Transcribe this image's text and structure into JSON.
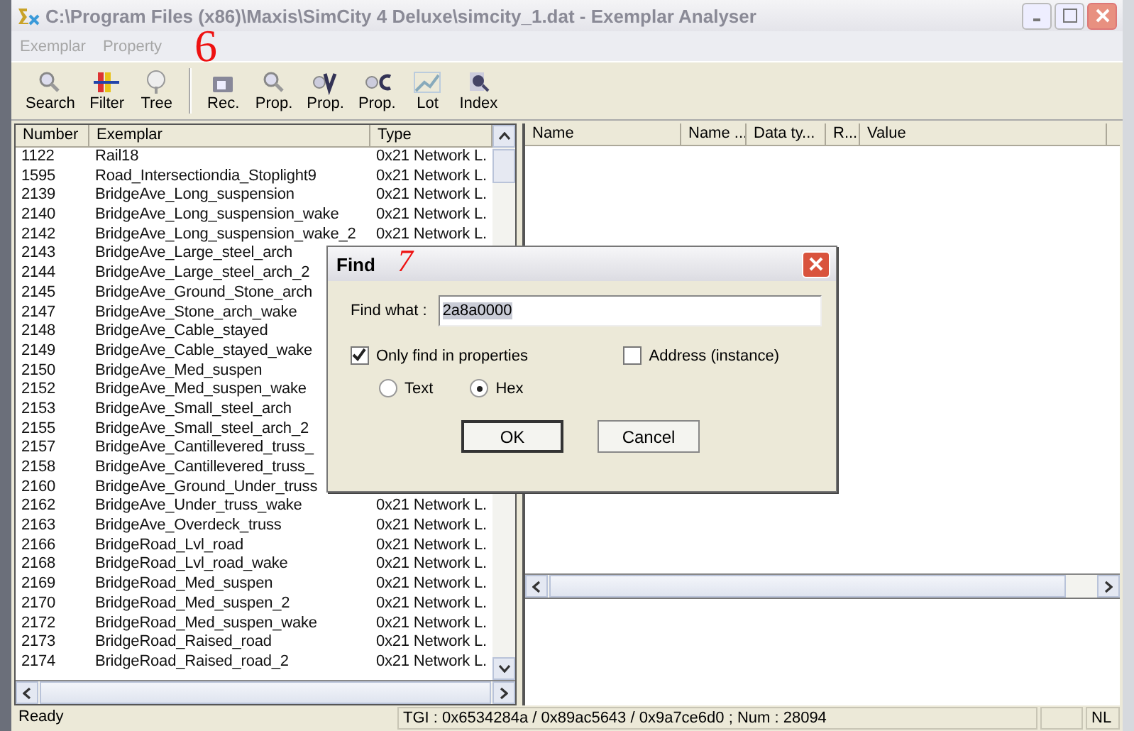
{
  "window": {
    "title": "C:\\Program Files (x86)\\Maxis\\SimCity 4 Deluxe\\simcity_1.dat - Exemplar Analyser"
  },
  "menu": [
    {
      "label": "Exemplar",
      "disabled": true
    },
    {
      "label": "Property",
      "disabled": true
    }
  ],
  "toolbar": [
    {
      "label": "Search",
      "kind": "search"
    },
    {
      "label": "Filter",
      "kind": "filter"
    },
    {
      "label": "Tree",
      "kind": "tree"
    },
    {
      "label": "Rec.",
      "kind": "rec"
    },
    {
      "label": "Prop.",
      "kind": "search"
    },
    {
      "label": "Prop.",
      "kind": "v"
    },
    {
      "label": "Prop.",
      "kind": "c"
    },
    {
      "label": "Lot",
      "kind": "lot"
    },
    {
      "label": "Index",
      "kind": "index"
    }
  ],
  "exemplar_list": {
    "columns": [
      "Number",
      "Exemplar",
      "Type"
    ],
    "rows": [
      {
        "number": "1122",
        "exemplar": "Rail18",
        "type": "0x21 Network L."
      },
      {
        "number": "1595",
        "exemplar": "Road_Intersectiondia_Stoplight9",
        "type": "0x21 Network L."
      },
      {
        "number": "2139",
        "exemplar": "BridgeAve_Long_suspension",
        "type": "0x21 Network L."
      },
      {
        "number": "2140",
        "exemplar": "BridgeAve_Long_suspension_wake",
        "type": "0x21 Network L."
      },
      {
        "number": "2142",
        "exemplar": "BridgeAve_Long_suspension_wake_2",
        "type": "0x21 Network L."
      },
      {
        "number": "2143",
        "exemplar": "BridgeAve_Large_steel_arch"
      },
      {
        "number": "2144",
        "exemplar": "BridgeAve_Large_steel_arch_2"
      },
      {
        "number": "2145",
        "exemplar": "BridgeAve_Ground_Stone_arch"
      },
      {
        "number": "2147",
        "exemplar": "BridgeAve_Stone_arch_wake"
      },
      {
        "number": "2148",
        "exemplar": "BridgeAve_Cable_stayed"
      },
      {
        "number": "2149",
        "exemplar": "BridgeAve_Cable_stayed_wake"
      },
      {
        "number": "2150",
        "exemplar": "BridgeAve_Med_suspen"
      },
      {
        "number": "2152",
        "exemplar": "BridgeAve_Med_suspen_wake"
      },
      {
        "number": "2153",
        "exemplar": "BridgeAve_Small_steel_arch"
      },
      {
        "number": "2155",
        "exemplar": "BridgeAve_Small_steel_arch_2"
      },
      {
        "number": "2157",
        "exemplar": "BridgeAve_Cantillevered_truss_"
      },
      {
        "number": "2158",
        "exemplar": "BridgeAve_Cantillevered_truss_"
      },
      {
        "number": "2160",
        "exemplar": "BridgeAve_Ground_Under_truss"
      },
      {
        "number": "2162",
        "exemplar": "BridgeAve_Under_truss_wake",
        "type": "0x21 Network L."
      },
      {
        "number": "2163",
        "exemplar": "BridgeAve_Overdeck_truss",
        "type": "0x21 Network L."
      },
      {
        "number": "2166",
        "exemplar": "BridgeRoad_Lvl_road",
        "type": "0x21 Network L."
      },
      {
        "number": "2168",
        "exemplar": "BridgeRoad_Lvl_road_wake",
        "type": "0x21 Network L."
      },
      {
        "number": "2169",
        "exemplar": "BridgeRoad_Med_suspen",
        "type": "0x21 Network L."
      },
      {
        "number": "2170",
        "exemplar": "BridgeRoad_Med_suspen_2",
        "type": "0x21 Network L."
      },
      {
        "number": "2172",
        "exemplar": "BridgeRoad_Med_suspen_wake",
        "type": "0x21 Network L."
      },
      {
        "number": "2173",
        "exemplar": "BridgeRoad_Raised_road",
        "type": "0x21 Network L."
      },
      {
        "number": "2174",
        "exemplar": "BridgeRoad_Raised_road_2",
        "type": "0x21 Network L."
      }
    ]
  },
  "property_list": {
    "columns": [
      "Name",
      "Name ...",
      "Data ty...",
      "R...",
      "Value"
    ]
  },
  "status_bar": {
    "message": "Ready",
    "info": "TGI : 0x6534284a / 0x89ac5643 / 0x9a7ce6d0 ; Num : 28094",
    "indicator": "NL"
  },
  "find_dialog": {
    "title": "Find",
    "field_label": "Find what :",
    "value": "2a8a0000",
    "options": [
      {
        "label": "Only find in properties",
        "checked": true
      },
      {
        "label": "Address (instance)",
        "checked": false
      }
    ],
    "modes": [
      {
        "label": "Text",
        "selected": false
      },
      {
        "label": "Hex",
        "selected": true
      }
    ],
    "buttons": [
      "OK",
      "Cancel"
    ]
  },
  "annotations": [
    "6",
    "7"
  ]
}
